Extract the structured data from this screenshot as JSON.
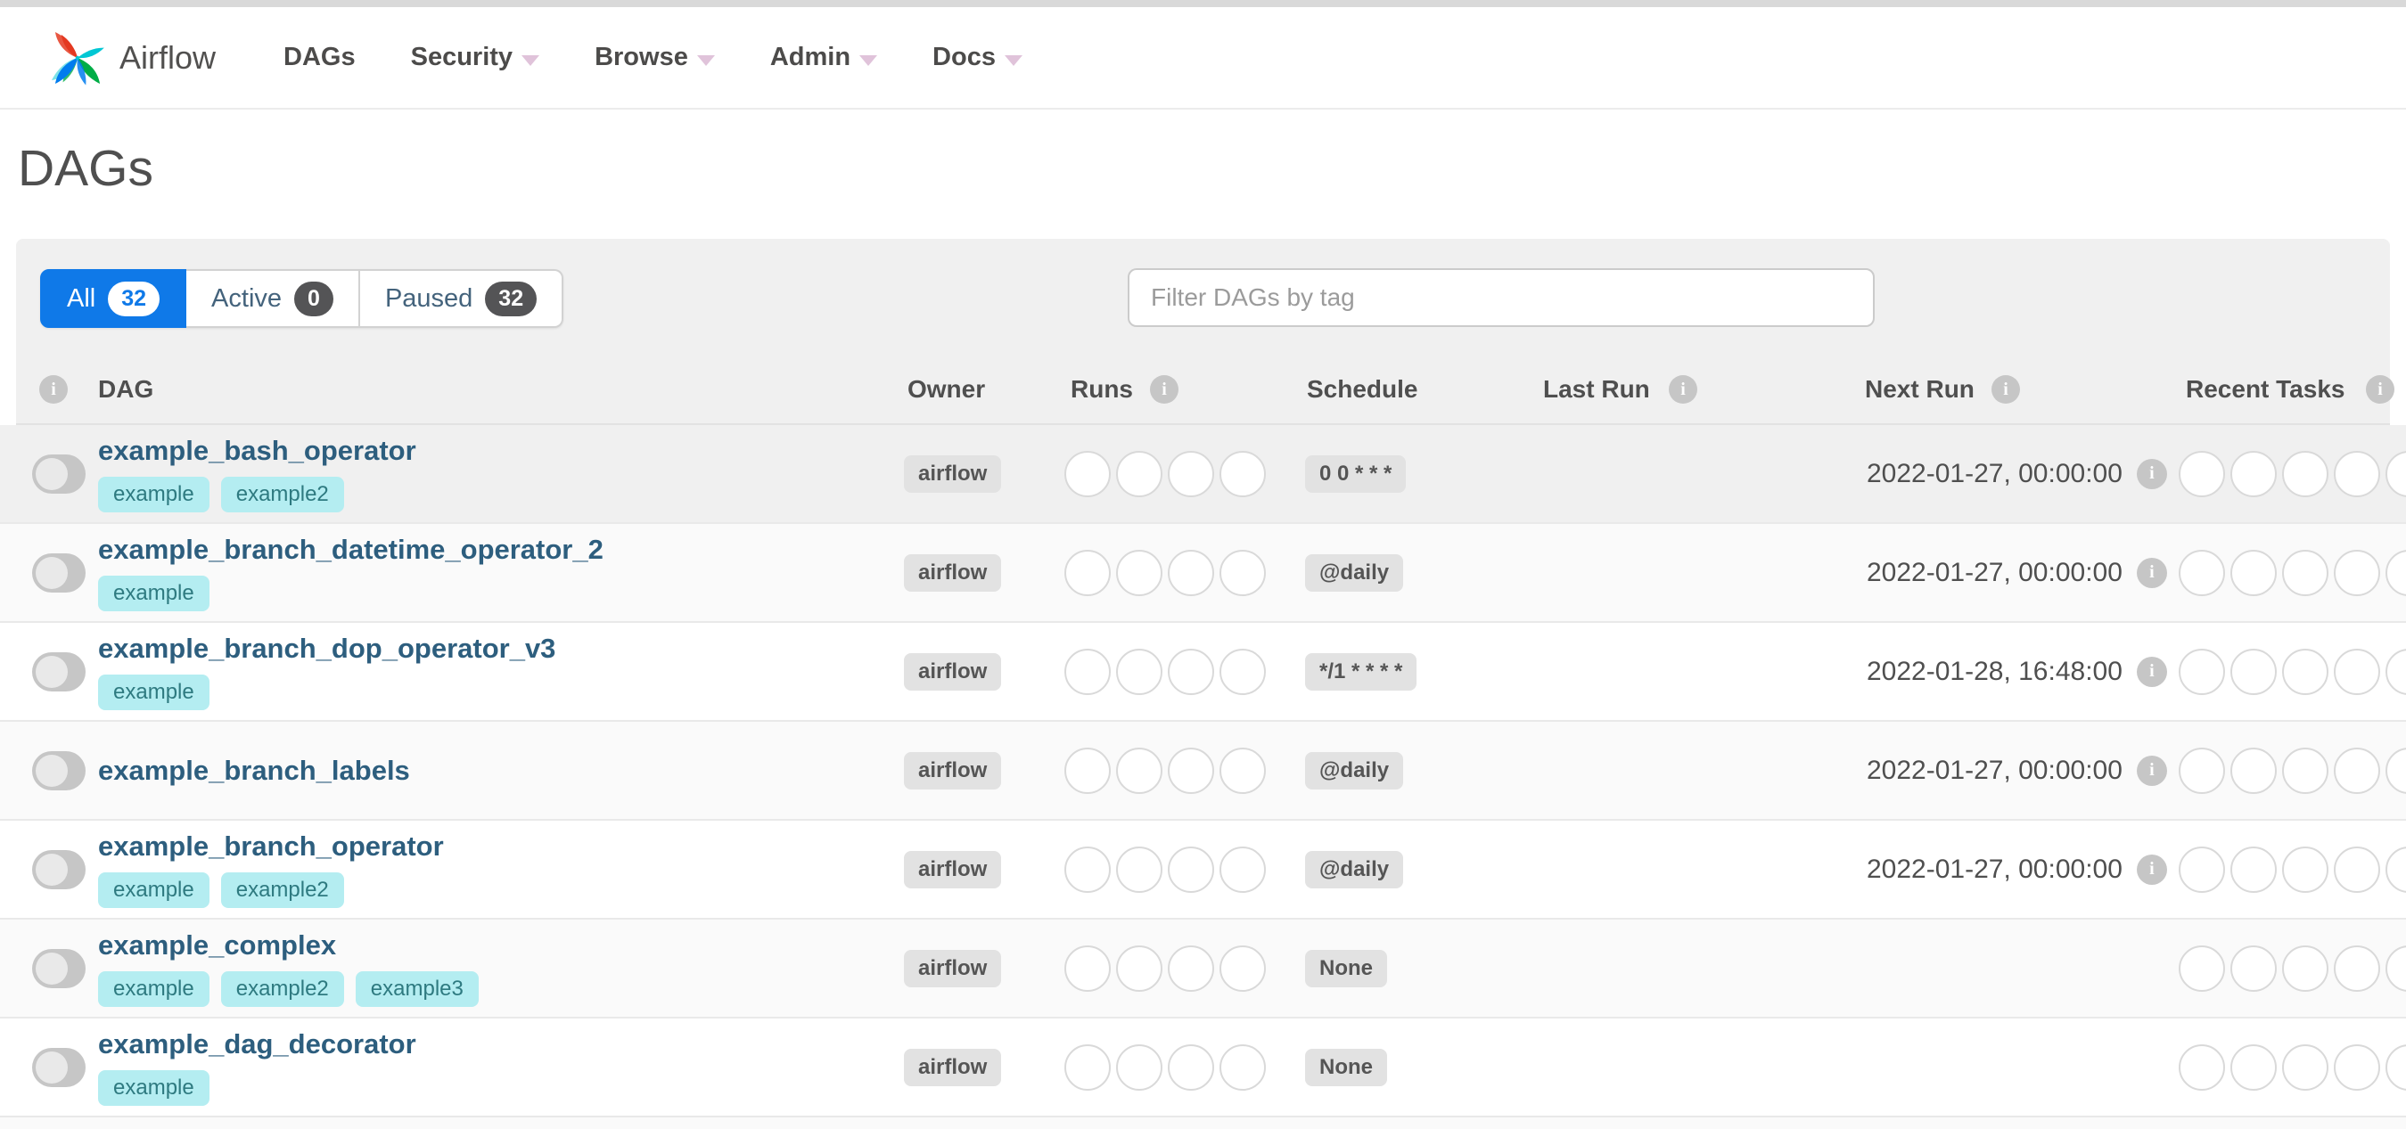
{
  "navbar": {
    "brand": "Airflow",
    "items": [
      {
        "label": "DAGs",
        "caret": false
      },
      {
        "label": "Security",
        "caret": true
      },
      {
        "label": "Browse",
        "caret": true
      },
      {
        "label": "Admin",
        "caret": true
      },
      {
        "label": "Docs",
        "caret": true
      }
    ]
  },
  "page": {
    "title": "DAGs"
  },
  "filters": {
    "tabs": [
      {
        "label": "All",
        "count": "32",
        "active": true
      },
      {
        "label": "Active",
        "count": "0",
        "active": false
      },
      {
        "label": "Paused",
        "count": "32",
        "active": false
      }
    ],
    "search_placeholder": "Filter DAGs by tag"
  },
  "table": {
    "columns": {
      "dag": "DAG",
      "owner": "Owner",
      "runs": "Runs",
      "schedule": "Schedule",
      "last_run": "Last Run",
      "next_run": "Next Run",
      "recent_tasks": "Recent Tasks"
    },
    "rows": [
      {
        "name": "example_bash_operator",
        "tags": [
          "example",
          "example2"
        ],
        "owner": "airflow",
        "schedule": "0 0 * * *",
        "last_run": "",
        "next_run": "2022-01-27, 00:00:00",
        "runs_count": 4,
        "recent_tasks_count": 5
      },
      {
        "name": "example_branch_datetime_operator_2",
        "tags": [
          "example"
        ],
        "owner": "airflow",
        "schedule": "@daily",
        "last_run": "",
        "next_run": "2022-01-27, 00:00:00",
        "runs_count": 4,
        "recent_tasks_count": 5
      },
      {
        "name": "example_branch_dop_operator_v3",
        "tags": [
          "example"
        ],
        "owner": "airflow",
        "schedule": "*/1 * * * *",
        "last_run": "",
        "next_run": "2022-01-28, 16:48:00",
        "runs_count": 4,
        "recent_tasks_count": 5
      },
      {
        "name": "example_branch_labels",
        "tags": [],
        "owner": "airflow",
        "schedule": "@daily",
        "last_run": "",
        "next_run": "2022-01-27, 00:00:00",
        "runs_count": 4,
        "recent_tasks_count": 5
      },
      {
        "name": "example_branch_operator",
        "tags": [
          "example",
          "example2"
        ],
        "owner": "airflow",
        "schedule": "@daily",
        "last_run": "",
        "next_run": "2022-01-27, 00:00:00",
        "runs_count": 4,
        "recent_tasks_count": 5
      },
      {
        "name": "example_complex",
        "tags": [
          "example",
          "example2",
          "example3"
        ],
        "owner": "airflow",
        "schedule": "None",
        "last_run": "",
        "next_run": "",
        "runs_count": 4,
        "recent_tasks_count": 5
      },
      {
        "name": "example_dag_decorator",
        "tags": [
          "example"
        ],
        "owner": "airflow",
        "schedule": "None",
        "last_run": "",
        "next_run": "",
        "runs_count": 4,
        "recent_tasks_count": 5
      }
    ]
  },
  "icons": {
    "info": "i",
    "logo": "airflow-pinwheel-logo"
  },
  "colors": {
    "accent_blue": "#0f79e8",
    "brand_text": "#51504f",
    "dag_link": "#2d5e7e",
    "tag_bg": "#b4edf1",
    "tag_text": "#2e7a80",
    "badge_bg": "#e2e2e2",
    "panel_bg": "#f0f0f0",
    "logo_red": "#e43921",
    "logo_cyan": "#00c7d4",
    "logo_green": "#00ad46",
    "logo_blue": "#017cee"
  }
}
